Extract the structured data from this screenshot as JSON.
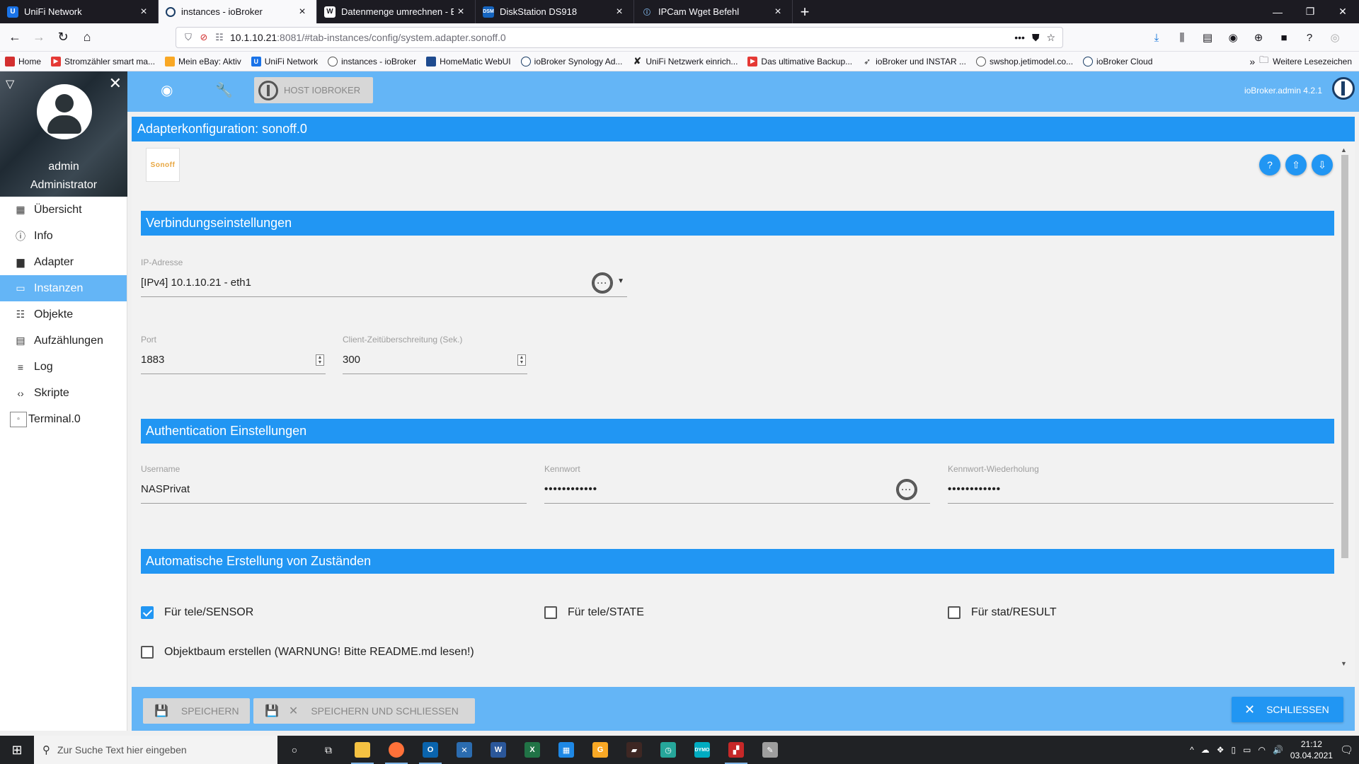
{
  "browser": {
    "tabs": [
      {
        "title": "UniFi Network",
        "icon_color": "#1a73e8",
        "icon_letter": "U",
        "active": false
      },
      {
        "title": "instances - ioBroker",
        "icon_color": "#ffffff",
        "icon_letter": "",
        "active": true
      },
      {
        "title": "Datenmenge umrechnen - Bit,",
        "icon_color": "#ffffff",
        "icon_letter": "",
        "active": false
      },
      {
        "title": "DiskStation DS918",
        "icon_color": "#1565c0",
        "icon_letter": "DSM",
        "active": false
      },
      {
        "title": "IPCam Wget Befehl",
        "icon_color": "#1c1b22",
        "icon_letter": "",
        "active": false
      }
    ],
    "url_host": "10.1.10.21",
    "url_rest": ":8081/#tab-instances/config/system.adapter.sonoff.0",
    "bookmarks": [
      {
        "label": "Home",
        "color": "#d32f2f"
      },
      {
        "label": "Stromzähler smart ma...",
        "color": "#e53935"
      },
      {
        "label": "Mein eBay: Aktiv",
        "color": "#f9a825"
      },
      {
        "label": "UniFi Network",
        "color": "#1a73e8"
      },
      {
        "label": "instances - ioBroker",
        "color": "#555555"
      },
      {
        "label": "HomeMatic WebUI",
        "color": "#1e4b8f"
      },
      {
        "label": "ioBroker Synology Ad...",
        "color": "#555555"
      },
      {
        "label": "UniFi Netzwerk einrich...",
        "color": "#222222"
      },
      {
        "label": "Das ultimative Backup...",
        "color": "#e53935"
      },
      {
        "label": "ioBroker und INSTAR ...",
        "color": "#333333"
      },
      {
        "label": "swshop.jetimodel.co...",
        "color": "#555555"
      },
      {
        "label": "ioBroker Cloud",
        "color": "#555555"
      }
    ],
    "bookmarks_more": "Weitere Lesezeichen"
  },
  "sidebar": {
    "username": "admin",
    "role": "Administrator",
    "items": [
      {
        "label": "Übersicht",
        "icon": "apps-icon",
        "active": false
      },
      {
        "label": "Info",
        "icon": "info-icon",
        "active": false
      },
      {
        "label": "Adapter",
        "icon": "store-icon",
        "active": false
      },
      {
        "label": "Instanzen",
        "icon": "instances-icon",
        "active": true
      },
      {
        "label": "Objekte",
        "icon": "list-icon",
        "active": false
      },
      {
        "label": "Aufzählungen",
        "icon": "enums-icon",
        "active": false
      },
      {
        "label": "Log",
        "icon": "log-icon",
        "active": false
      },
      {
        "label": "Skripte",
        "icon": "code-icon",
        "active": false
      },
      {
        "label": "Terminal.0",
        "icon": "terminal-icon",
        "active": false
      }
    ]
  },
  "header": {
    "host_button": "HOST IOBROKER",
    "version": "ioBroker.admin 4.2.1"
  },
  "dialog": {
    "title": "Adapterkonfiguration: sonoff.0",
    "logo_text": "Sonoff",
    "sections": {
      "connection": "Verbindungseinstellungen",
      "auth": "Authentication Einstellungen",
      "states": "Automatische Erstellung von Zuständen"
    },
    "fields": {
      "ip_label": "IP-Adresse",
      "ip_value": "[IPv4] 10.1.10.21 - eth1",
      "port_label": "Port",
      "port_value": "1883",
      "timeout_label": "Client-Zeitüberschreitung (Sek.)",
      "timeout_value": "300",
      "user_label": "Username",
      "user_value": "NASPrivat",
      "password_label": "Kennwort",
      "password_value": "••••••••••••",
      "password_repeat_label": "Kennwort-Wiederholung",
      "password_repeat_value": "••••••••••••"
    },
    "checkboxes": [
      {
        "label": "Für tele/SENSOR",
        "checked": true
      },
      {
        "label": "Für tele/STATE",
        "checked": false
      },
      {
        "label": "Für stat/RESULT",
        "checked": false
      },
      {
        "label": "Objektbaum erstellen (WARNUNG! Bitte README.md lesen!)",
        "checked": false
      }
    ],
    "footer": {
      "save": "SPEICHERN",
      "save_close": "SPEICHERN UND SCHLIESSEN",
      "close": "SCHLIESSEN"
    }
  },
  "taskbar": {
    "search_placeholder": "Zur Suche Text hier eingeben",
    "time": "21:12",
    "date": "03.04.2021"
  }
}
